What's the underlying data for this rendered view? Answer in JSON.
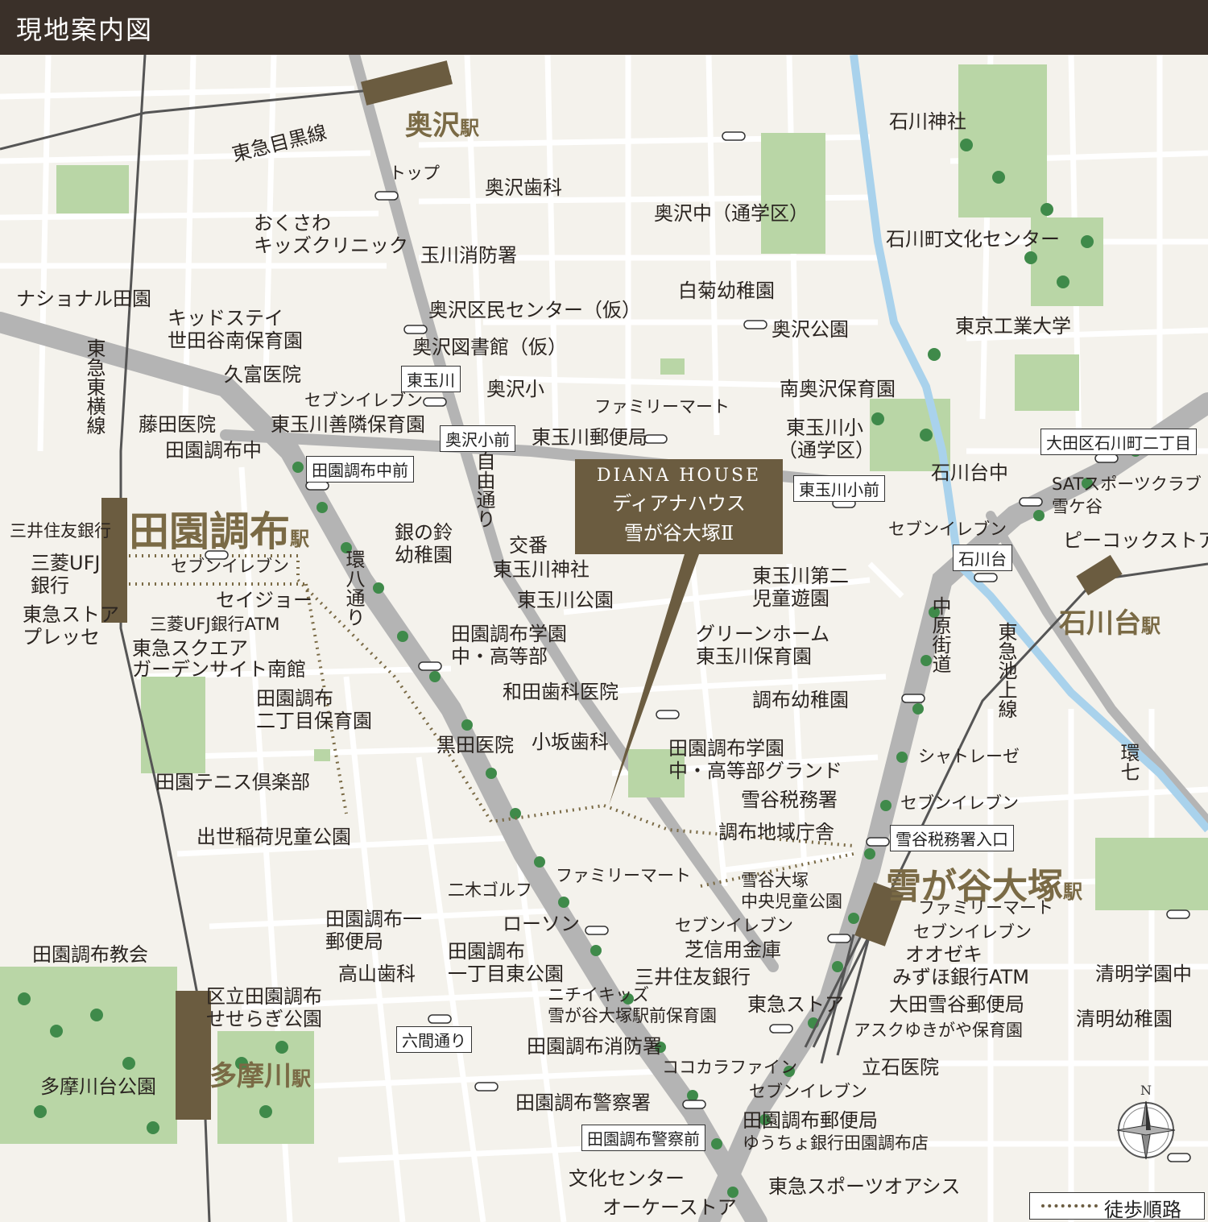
{
  "header": {
    "title": "現地案内図"
  },
  "callout": {
    "en": "DIANA HOUSE",
    "ja_line1": "ディアナハウス",
    "ja_line2": "雪が谷大塚Ⅱ"
  },
  "stations": {
    "okusawa": {
      "name": "奥沢",
      "suffix": "駅"
    },
    "denenchofu": {
      "name": "田園調布",
      "suffix": "駅"
    },
    "ishikawadai": {
      "name": "石川台",
      "suffix": "駅"
    },
    "yukigaya": {
      "name": "雪が谷大塚",
      "suffix": "駅"
    },
    "tamagawa": {
      "name": "多摩川",
      "suffix": "駅"
    }
  },
  "lines": {
    "meguro": "東急目黒線",
    "toyoko": "東急東横線",
    "ikegami": "東急池上線"
  },
  "roads": {
    "jiyu": "自由通り",
    "kanpachi": "環八通り",
    "nakahara": "中原街道",
    "kan7": "環七"
  },
  "bus_stops": [
    "東玉川",
    "奥沢小前",
    "田園調布中前",
    "東玉川小前",
    "大田区石川町二丁目",
    "石川台",
    "雪谷税務署入口",
    "六間通り",
    "田園調布警察前"
  ],
  "labels": {
    "top": "トップ",
    "okusawa_dental": "奥沢歯科",
    "okusawa_kids_1": "おくさわ",
    "okusawa_kids_2": "キッズクリニック",
    "fire_tamagawa": "玉川消防署",
    "national": "ナショナル田園",
    "kidstay_1": "キッドステイ",
    "kidstay_2": "世田谷南保育園",
    "okusawa_kumin": "奥沢区民センター（仮）",
    "okusawa_lib": "奥沢図書館（仮）",
    "kutomi": "久富医院",
    "seven_1": "セブンイレブン",
    "higashitamagawa_zenrin": "東玉川善隣保育園",
    "fujita": "藤田医院",
    "denen_chu": "田園調布中",
    "okusawa_sho": "奥沢小",
    "familymart_1": "ファミリーマート",
    "higashitamagawa_post": "東玉川郵便局",
    "ishikawa_jinja": "石川神社",
    "okusawa_chu": "奥沢中（通学区）",
    "ishikawacho_bunka": "石川町文化センター",
    "shiragiku": "白菊幼稚園",
    "okusawa_park": "奥沢公園",
    "tokodai": "東京工業大学",
    "minamiokusawa": "南奥沢保育園",
    "higashitamagawa_sho_1": "東玉川小",
    "higashitamagawa_sho_2": "（通学区）",
    "ishikawadai_chu": "石川台中",
    "sat_1": "SATスポーツクラブ",
    "sat_2": "雪ケ谷",
    "peacock": "ピーコックストア",
    "seven_2": "セブンイレブン",
    "mitsui_1": "三井住友銀行",
    "mufj_1": "三菱UFJ",
    "mufj_2": "銀行",
    "seven_3": "セブンイレブン",
    "seijo": "セイジョー",
    "tokyu_store_presse_1": "東急ストア",
    "tokyu_store_presse_2": "プレッセ",
    "mufj_atm": "三菱UFJ銀行ATM",
    "tokyu_square_1": "東急スクエア",
    "tokyu_square_2": "ガーデンサイト南館",
    "gin_no_suzu_1": "銀の鈴",
    "gin_no_suzu_2": "幼稚園",
    "koban": "交番",
    "higashitamagawa_jinja": "東玉川神社",
    "higashitamagawa_park": "東玉川公園",
    "higashitamagawa_2jido_1": "東玉川第二",
    "higashitamagawa_2jido_2": "児童遊園",
    "denen_gakuen_1": "田園調布学園",
    "denen_gakuen_2": "中・高等部",
    "greenhome_1": "グリーンホーム",
    "greenhome_2": "東玉川保育園",
    "denen_2chome_1": "田園調布",
    "denen_2chome_2": "二丁目保育園",
    "wada": "和田歯科医院",
    "chofu_yochien": "調布幼稚園",
    "kuroda": "黒田医院",
    "kosaka": "小坂歯科",
    "denen_ground_1": "田園調布学園",
    "denen_ground_2": "中・高等部グランド",
    "chateraise": "シャトレーゼ",
    "denen_tennis": "田園テニス倶楽部",
    "yukigaya_zeimu": "雪谷税務署",
    "seven_4": "セブンイレブン",
    "shusse_inari": "出世稲荷児童公園",
    "chofu_chiiki": "調布地域庁舎",
    "niki_golf": "二木ゴルフ",
    "familymart_2": "ファミリーマート",
    "yukigaya_park_1": "雪谷大塚",
    "yukigaya_park_2": "中央児童公園",
    "familymart_3": "ファミリーマート",
    "denen_post1_1": "田園調布一",
    "denen_post1_2": "郵便局",
    "lawson": "ローソン",
    "seven_5": "セブンイレブン",
    "seven_6": "セブンイレブン",
    "okazeki": "オオゼキ",
    "denen_church": "田園調布教会",
    "shibashin": "芝信用金庫",
    "denen_1chome_1": "田園調布",
    "denen_1chome_2": "一丁目東公園",
    "takayama": "高山歯科",
    "mitsui_2": "三井住友銀行",
    "mizuho": "みずほ銀行ATM",
    "seimei_chu": "清明学園中",
    "seseragi_1": "区立田園調布",
    "seseragi_2": "せせらぎ公園",
    "nichii_1": "ニチイキッズ",
    "nichii_2": "雪が谷大塚駅前保育園",
    "tokyu_store_2": "東急ストア",
    "ota_yukigaya_post": "大田雪谷郵便局",
    "seimei_yochien": "清明幼稚園",
    "ask": "アスクゆきがや保育園",
    "denen_fire": "田園調布消防署",
    "cocokara": "ココカラファイン",
    "tateishi": "立石医院",
    "tamagawadai_park": "多摩川台公園",
    "denen_police": "田園調布警察署",
    "seven_7": "セブンイレブン",
    "denen_post_1": "田園調布郵便局",
    "denen_post_2": "ゆうちょ銀行田園調布店",
    "bunka_center": "文化センター",
    "okay_store": "オーケーストア",
    "tokyu_sports": "東急スポーツオアシス"
  },
  "legend": {
    "walk_route": "徒歩順路"
  },
  "compass": {
    "north": "N"
  },
  "colors": {
    "header": "#3a3029",
    "background": "#f4f2ec",
    "road_major": "#b4b4b4",
    "road_minor": "#ffffff",
    "park": "#b9d6a6",
    "tree": "#3f8a4a",
    "river": "#a9d2ec",
    "station_brown": "#6b5c40",
    "walk_route": "#7a6a45"
  }
}
